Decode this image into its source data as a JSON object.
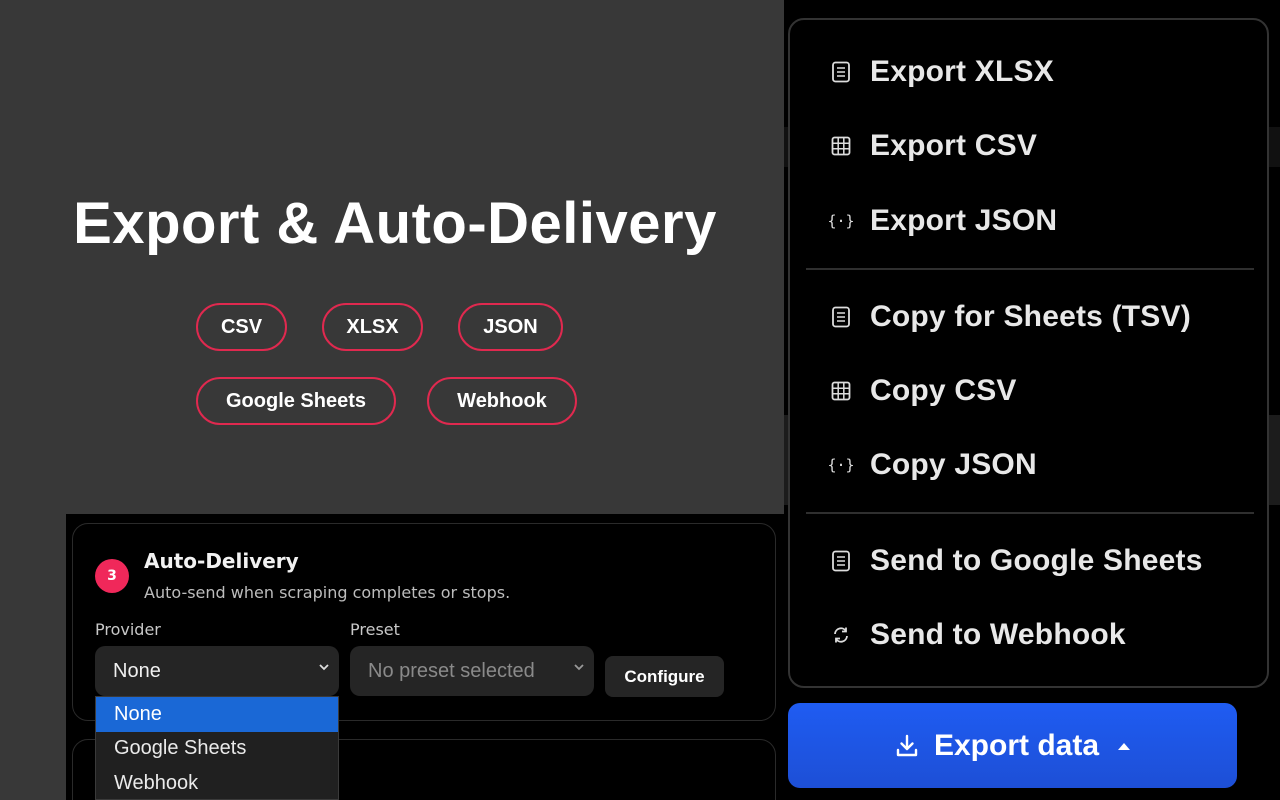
{
  "hero": {
    "title": "Export & Auto-Delivery",
    "chips": [
      "CSV",
      "XLSX",
      "JSON",
      "Google Sheets",
      "Webhook"
    ]
  },
  "auto_delivery": {
    "step": "3",
    "title": "Auto-Delivery",
    "subtitle": "Auto-send when scraping completes or stops.",
    "provider_label": "Provider",
    "provider_value": "None",
    "preset_label": "Preset",
    "preset_placeholder": "No preset selected",
    "configure_label": "Configure",
    "provider_options": [
      "None",
      "Google Sheets",
      "Webhook"
    ]
  },
  "export_menu": {
    "items": [
      {
        "label": "Export XLSX",
        "icon": "document-icon"
      },
      {
        "label": "Export CSV",
        "icon": "grid-icon"
      },
      {
        "label": "Export JSON",
        "icon": "braces-icon"
      },
      {
        "label": "Copy for Sheets (TSV)",
        "icon": "document-icon"
      },
      {
        "label": "Copy CSV",
        "icon": "grid-icon"
      },
      {
        "label": "Copy JSON",
        "icon": "braces-icon"
      },
      {
        "label": "Send to Google Sheets",
        "icon": "document-icon"
      },
      {
        "label": "Send to Webhook",
        "icon": "sync-icon"
      }
    ]
  },
  "export_button": {
    "label": "Export data",
    "icon": "download-icon",
    "caret": "caret-up-icon"
  },
  "colors": {
    "accent_red": "#e0294f",
    "badge_red": "#f0285a",
    "primary_blue": "#1f5cf2",
    "selected_blue": "#1a68d6"
  }
}
